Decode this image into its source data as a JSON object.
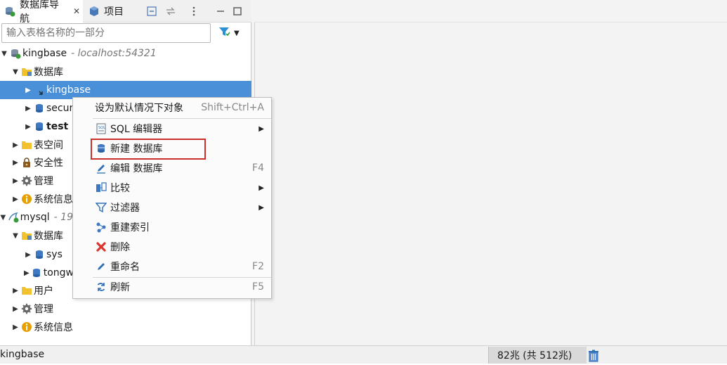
{
  "tabs": [
    {
      "label": "数据库导航",
      "close": "✕"
    },
    {
      "label": "项目"
    }
  ],
  "search": {
    "placeholder": "输入表格名称的一部分"
  },
  "tree": {
    "kingbase_conn": {
      "name": "kingbase",
      "host": "- localhost:54321"
    },
    "kb_databases": "数据库",
    "kb_db_kingbase": "kingbase",
    "kb_db_security": "secur",
    "kb_db_test": "test",
    "kb_tablespace": "表空间",
    "kb_security": "安全性",
    "kb_admin": "管理",
    "kb_sysinfo": "系统信息",
    "mysql_conn": {
      "name": "mysql",
      "host": "- 19"
    },
    "my_databases": "数据库",
    "my_db_sys": "sys",
    "my_db_tongw": "tongw",
    "my_users": "用户",
    "my_admin": "管理",
    "my_sysinfo": "系统信息"
  },
  "context_menu": {
    "set_default": {
      "label": "设为默认情况下对象",
      "shortcut": "Shift+Ctrl+A"
    },
    "sql_editor": {
      "label": "SQL 编辑器"
    },
    "new_db": {
      "label": "新建 数据库"
    },
    "edit_db": {
      "label": "编辑 数据库",
      "shortcut": "F4"
    },
    "compare": {
      "label": "比较"
    },
    "filter": {
      "label": "过滤器"
    },
    "rebuild_index": {
      "label": "重建索引"
    },
    "delete": {
      "label": "删除"
    },
    "rename": {
      "label": "重命名",
      "shortcut": "F2"
    },
    "refresh": {
      "label": "刷新",
      "shortcut": "F5"
    }
  },
  "status": {
    "selection": "kingbase",
    "memory": "82兆 (共 512兆)"
  },
  "colors": {
    "selection": "#4a90d9",
    "highlight": "#c9302c",
    "accent": "#1e73be"
  }
}
